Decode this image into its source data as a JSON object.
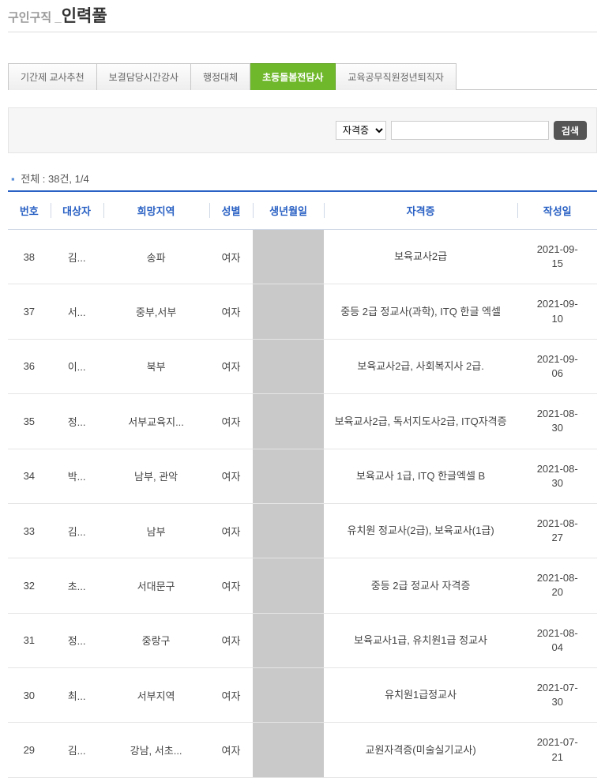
{
  "title": {
    "prefix": "구인구직 _",
    "main": "인력풀"
  },
  "tabs": [
    {
      "label": "기간제 교사추천"
    },
    {
      "label": "보결담당시간강사"
    },
    {
      "label": "행정대체"
    },
    {
      "label": "초등돌봄전담사",
      "active": true
    },
    {
      "label": "교육공무직원정년퇴직자"
    }
  ],
  "filter": {
    "select_label": "자격증",
    "search_button": "검색",
    "input_value": ""
  },
  "summary": {
    "text": "전체 : 38건, 1/4"
  },
  "columns": {
    "no": "번호",
    "name": "대상자",
    "area": "희망지역",
    "sex": "성별",
    "birth": "생년월일",
    "cert": "자격증",
    "date": "작성일"
  },
  "rows": [
    {
      "no": 38,
      "name": "김...",
      "area": "송파",
      "sex": "여자",
      "cert": "보육교사2급",
      "date": "2021-09-15"
    },
    {
      "no": 37,
      "name": "서...",
      "area": "중부,서부",
      "sex": "여자",
      "cert": "중등 2급 정교사(과학), ITQ 한글 엑셀",
      "date": "2021-09-10"
    },
    {
      "no": 36,
      "name": "이...",
      "area": "북부",
      "sex": "여자",
      "cert": "보육교사2급, 사회복지사 2급.",
      "date": "2021-09-06"
    },
    {
      "no": 35,
      "name": "정...",
      "area": "서부교육지...",
      "sex": "여자",
      "cert": "보육교사2급, 독서지도사2급, ITQ자격증",
      "date": "2021-08-30"
    },
    {
      "no": 34,
      "name": "박...",
      "area": "남부, 관악",
      "sex": "여자",
      "cert": "보육교사 1급, ITQ 한글엑셀 B",
      "date": "2021-08-30"
    },
    {
      "no": 33,
      "name": "김...",
      "area": "남부",
      "sex": "여자",
      "cert": "유치원 정교사(2급), 보육교사(1급)",
      "date": "2021-08-27"
    },
    {
      "no": 32,
      "name": "초...",
      "area": "서대문구",
      "sex": "여자",
      "cert": "중등 2급 정교사 자격증",
      "date": "2021-08-20"
    },
    {
      "no": 31,
      "name": "정...",
      "area": "중랑구",
      "sex": "여자",
      "cert": "보육교사1급, 유치원1급 정교사",
      "date": "2021-08-04"
    },
    {
      "no": 30,
      "name": "최...",
      "area": "서부지역",
      "sex": "여자",
      "cert": "유치원1급정교사",
      "date": "2021-07-30"
    },
    {
      "no": 29,
      "name": "김...",
      "area": "강남, 서초...",
      "sex": "여자",
      "cert": "교원자격증(미술실기교사)",
      "date": "2021-07-21"
    }
  ]
}
